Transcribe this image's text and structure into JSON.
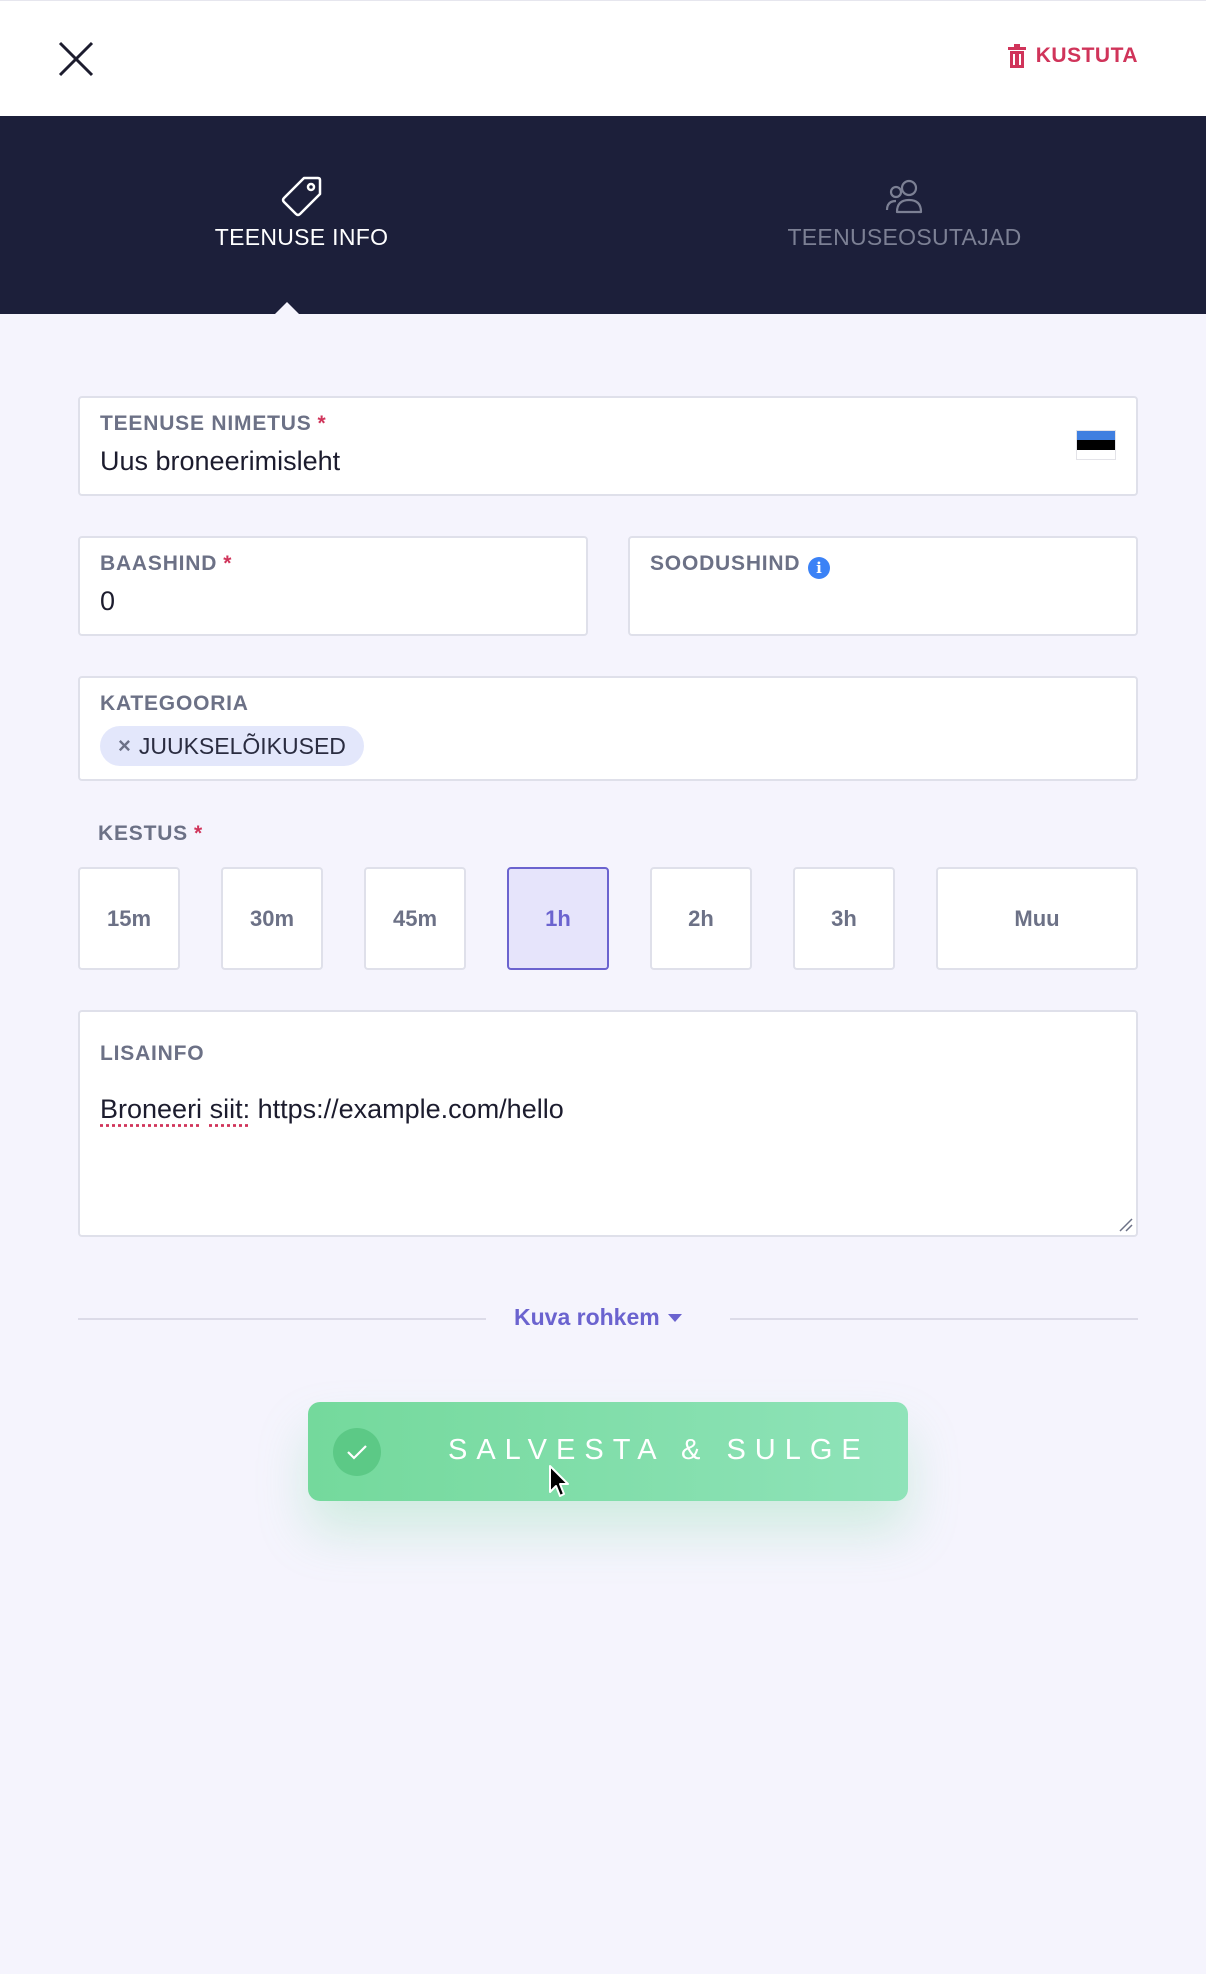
{
  "header": {
    "delete_label": "KUSTUTA"
  },
  "tabs": [
    {
      "label": "TEENUSE INFO",
      "icon": "tag-icon",
      "active": true
    },
    {
      "label": "TEENUSEOSUTAJAD",
      "icon": "users-icon",
      "active": false
    }
  ],
  "form": {
    "service_name": {
      "label": "TEENUSE NIMETUS",
      "required_mark": "*",
      "value": "Uus broneerimisleht",
      "language_flag": "estonia-flag-icon"
    },
    "base_price": {
      "label": "BAASHIND",
      "required_mark": "*",
      "value": "0"
    },
    "discount_price": {
      "label": "SOODUSHIND",
      "info_icon": "i",
      "value": ""
    },
    "category": {
      "label": "KATEGOORIA",
      "chips": [
        "JUUKSELÕIKUSED"
      ],
      "chip_remove": "×"
    },
    "duration": {
      "label": "KESTUS",
      "required_mark": "*",
      "options": [
        "15m",
        "30m",
        "45m",
        "1h",
        "2h",
        "3h",
        "Muu"
      ],
      "selected": "1h"
    },
    "extra_info": {
      "label": "LISAINFO",
      "value_word1": "Broneeri",
      "value_word2": "siit:",
      "value_rest": " https://example.com/hello"
    }
  },
  "more": {
    "label": "Kuva rohkem"
  },
  "save_button": {
    "label": "SALVESTA & SULGE"
  },
  "colors": {
    "accent": "#6b63cf",
    "danger": "#d0345a",
    "save_green": "#74d99c",
    "tab_bar": "#1c1f3a",
    "background": "#f5f4fd"
  }
}
